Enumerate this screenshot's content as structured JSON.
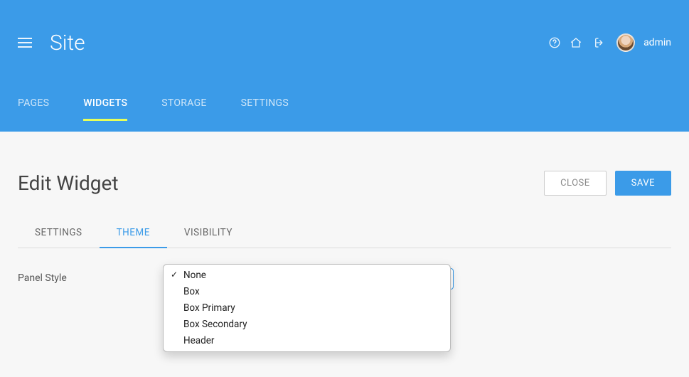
{
  "header": {
    "site_title": "Site",
    "user": {
      "name": "admin"
    },
    "tabs": [
      {
        "label": "PAGES"
      },
      {
        "label": "WIDGETS"
      },
      {
        "label": "STORAGE"
      },
      {
        "label": "SETTINGS"
      }
    ],
    "active_tab_index": 1
  },
  "page": {
    "title": "Edit Widget",
    "buttons": {
      "close": "CLOSE",
      "save": "SAVE"
    },
    "sub_tabs": [
      {
        "label": "SETTINGS"
      },
      {
        "label": "THEME"
      },
      {
        "label": "VISIBILITY"
      }
    ],
    "active_sub_tab_index": 1,
    "form": {
      "panel_style": {
        "label": "Panel Style",
        "selected": "None",
        "options": [
          "None",
          "Box",
          "Box Primary",
          "Box Secondary",
          "Header"
        ]
      }
    }
  }
}
